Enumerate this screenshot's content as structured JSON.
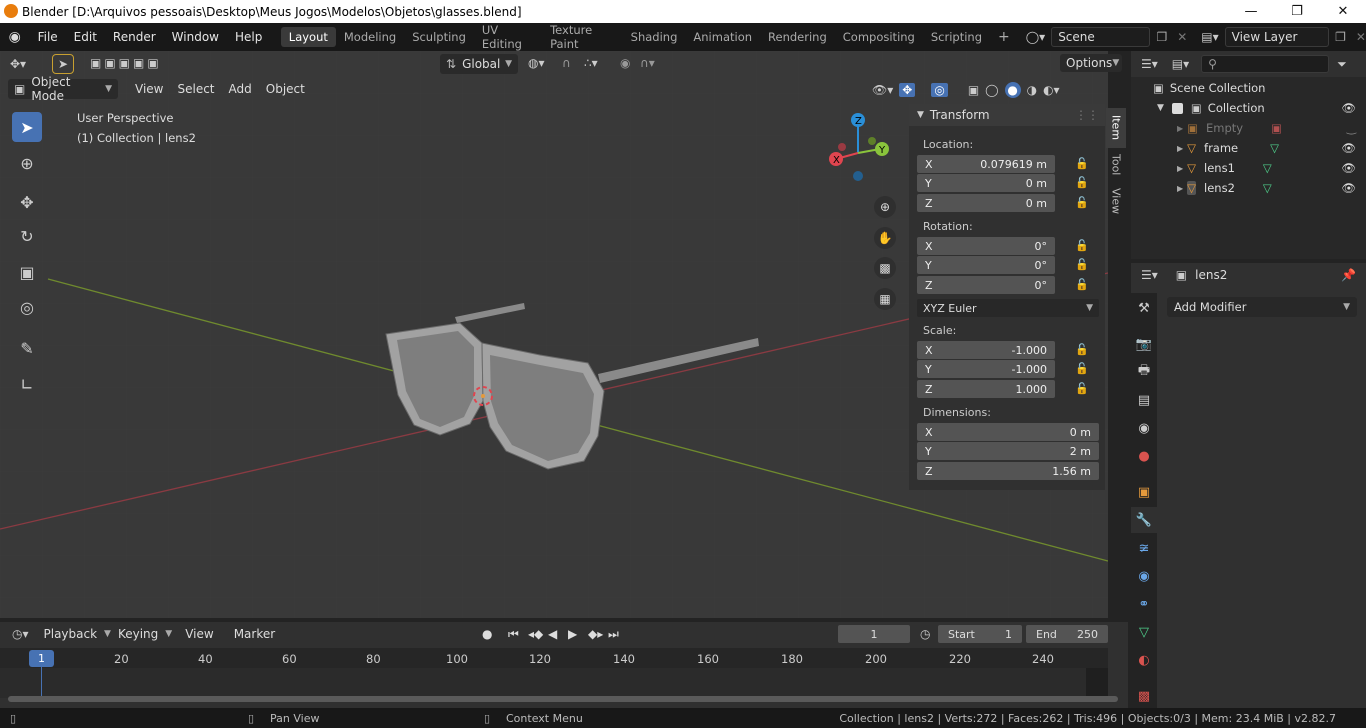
{
  "window": {
    "title": "Blender [D:\\Arquivos pessoais\\Desktop\\Meus Jogos\\Modelos\\Objetos\\glasses.blend]"
  },
  "menu": [
    "File",
    "Edit",
    "Render",
    "Window",
    "Help"
  ],
  "workspaces": [
    "Layout",
    "Modeling",
    "Sculpting",
    "UV Editing",
    "Texture Paint",
    "Shading",
    "Animation",
    "Rendering",
    "Compositing",
    "Scripting"
  ],
  "active_workspace": "Layout",
  "scene": {
    "name": "Scene"
  },
  "view_layer": {
    "name": "View Layer"
  },
  "viewport": {
    "mode": "Object Mode",
    "menus": [
      "View",
      "Select",
      "Add",
      "Object"
    ],
    "orientation": "Global",
    "options_label": "Options",
    "overlay_line1": "User Perspective",
    "overlay_line2": "(1) Collection | lens2",
    "gizmo": {
      "x": "X",
      "y": "Y",
      "z": "Z"
    }
  },
  "npanel": {
    "header": "Transform",
    "tabs": [
      "Item",
      "Tool",
      "View"
    ],
    "location_label": "Location:",
    "location": [
      {
        "axis": "X",
        "value": "0.079619 m"
      },
      {
        "axis": "Y",
        "value": "0 m"
      },
      {
        "axis": "Z",
        "value": "0 m"
      }
    ],
    "rotation_label": "Rotation:",
    "rotation": [
      {
        "axis": "X",
        "value": "0°"
      },
      {
        "axis": "Y",
        "value": "0°"
      },
      {
        "axis": "Z",
        "value": "0°"
      }
    ],
    "rotation_mode": "XYZ Euler",
    "scale_label": "Scale:",
    "scale": [
      {
        "axis": "X",
        "value": "-1.000"
      },
      {
        "axis": "Y",
        "value": "-1.000"
      },
      {
        "axis": "Z",
        "value": "1.000"
      }
    ],
    "dimensions_label": "Dimensions:",
    "dimensions": [
      {
        "axis": "X",
        "value": "0 m"
      },
      {
        "axis": "Y",
        "value": "2 m"
      },
      {
        "axis": "Z",
        "value": "1.56 m"
      }
    ]
  },
  "outliner": {
    "scene_collection": "Scene Collection",
    "collection": "Collection",
    "items": [
      "Empty",
      "frame",
      "lens1",
      "lens2"
    ]
  },
  "properties": {
    "object_name": "lens2",
    "add_modifier": "Add Modifier"
  },
  "timeline": {
    "menus": [
      "Playback",
      "Keying",
      "View",
      "Marker"
    ],
    "current_frame": "1",
    "start_label": "Start",
    "start": "1",
    "end_label": "End",
    "end": "250",
    "ruler": [
      "1",
      "20",
      "40",
      "60",
      "80",
      "100",
      "120",
      "140",
      "160",
      "180",
      "200",
      "220",
      "240"
    ]
  },
  "statusbar": {
    "pan": "Pan View",
    "context": "Context Menu",
    "stats": "Collection | lens2 | Verts:272 | Faces:262 | Tris:496 | Objects:0/3 | Mem: 23.4 MiB | v2.82.7"
  },
  "colors": {
    "accent": "#4772b3",
    "x_axis": "#e0454f",
    "y_axis": "#8ac43c",
    "z_axis": "#2a8fd8",
    "mesh_icon": "#4fcf8b",
    "orange": "#e59a3c"
  }
}
